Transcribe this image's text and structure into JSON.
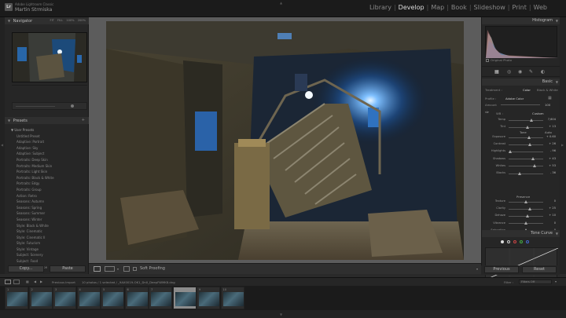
{
  "app": {
    "brand_small": "Adobe Lightroom Classic",
    "brand_name": "Martin Strmiska",
    "logo": "Lr"
  },
  "modules": [
    "Library",
    "Develop",
    "Map",
    "Book",
    "Slideshow",
    "Print",
    "Web"
  ],
  "active_module": "Develop",
  "left_panel": {
    "navigator_title": "Navigator",
    "navigator_zoom": [
      "FIT",
      "FILL",
      "100%",
      "200%"
    ],
    "presets_title": "Presets",
    "presets": [
      {
        "label": "User Presets",
        "type": "group"
      },
      {
        "label": "Untitled Preset",
        "type": "sub"
      },
      {
        "label": "Adaptive: Portrait",
        "type": "item"
      },
      {
        "label": "Adaptive: Sky",
        "type": "item"
      },
      {
        "label": "Adaptive: Subject",
        "type": "item"
      },
      {
        "label": "Portraits: Deep Skin",
        "type": "item"
      },
      {
        "label": "Portraits: Medium Skin",
        "type": "item"
      },
      {
        "label": "Portraits: Light Skin",
        "type": "item"
      },
      {
        "label": "Portraits: Black & White",
        "type": "item"
      },
      {
        "label": "Portraits: Edgy",
        "type": "item"
      },
      {
        "label": "Portraits: Group",
        "type": "item"
      },
      {
        "label": "Action: Retro",
        "type": "item"
      },
      {
        "label": "Seasons: Autumn",
        "type": "item"
      },
      {
        "label": "Seasons: Spring",
        "type": "item"
      },
      {
        "label": "Seasons: Summer",
        "type": "item"
      },
      {
        "label": "Seasons: Winter",
        "type": "item"
      },
      {
        "label": "Style: Black & White",
        "type": "item"
      },
      {
        "label": "Style: Cinematic",
        "type": "item"
      },
      {
        "label": "Style: Cinematic II",
        "type": "item"
      },
      {
        "label": "Style: Futurism",
        "type": "item"
      },
      {
        "label": "Style: Vintage",
        "type": "item"
      },
      {
        "label": "Subject: Scenery",
        "type": "item"
      },
      {
        "label": "Subject: Food",
        "type": "item"
      },
      {
        "label": "Subject: Landscape",
        "type": "item"
      }
    ],
    "copy_label": "Copy...",
    "paste_label": "Paste"
  },
  "toolbar": {
    "soft_proofing": "Soft Proofing"
  },
  "right_panel": {
    "histogram_title": "Histogram",
    "histogram_info": "Original Photo",
    "basic_title": "Basic",
    "treatment_label": "Treatment :",
    "treatment_color": "Color",
    "treatment_bw": "Black & White",
    "profile_label": "Profile :",
    "profile_value": "Adobe Color",
    "amount_label": "Amount",
    "amount_value": "100",
    "wb_label": "WB :",
    "wb_value": "Custom",
    "tone_label": "Tone",
    "auto_label": "Auto",
    "presence_label": "Presence",
    "tone_curve_title": "Tone Curve",
    "previous_label": "Previous",
    "reset_label": "Reset",
    "sliders": [
      {
        "label": "Temp",
        "value": "7,604",
        "pos": 0.66,
        "section": "wb"
      },
      {
        "label": "Tint",
        "value": "+ 13",
        "pos": 0.55,
        "section": "wb"
      },
      {
        "label": "Exposure",
        "value": "+ 0.60",
        "pos": 0.58,
        "section": "tone"
      },
      {
        "label": "Contrast",
        "value": "+ 26",
        "pos": 0.62,
        "section": "tone"
      },
      {
        "label": "Highlights",
        "value": "- 96",
        "pos": 0.05,
        "section": "tone"
      },
      {
        "label": "Shadows",
        "value": "+ 43",
        "pos": 0.71,
        "section": "tone"
      },
      {
        "label": "Whites",
        "value": "+ 53",
        "pos": 0.76,
        "section": "tone"
      },
      {
        "label": "Blacks",
        "value": "- 36",
        "pos": 0.32,
        "section": "tone"
      },
      {
        "label": "Texture",
        "value": "0",
        "pos": 0.5,
        "section": "presence"
      },
      {
        "label": "Clarity",
        "value": "+ 25",
        "pos": 0.62,
        "section": "presence"
      },
      {
        "label": "Dehaze",
        "value": "+ 10",
        "pos": 0.55,
        "section": "presence"
      },
      {
        "label": "Vibrance",
        "value": "0",
        "pos": 0.5,
        "section": "presence"
      },
      {
        "label": "Saturation",
        "value": "0",
        "pos": 0.5,
        "section": "presence"
      }
    ]
  },
  "filmstrip": {
    "previous_import": "Previous Import",
    "info": "10 photos / 1 selected / _9AX0019-OK1_Dn0_DeepFWMK8.dng",
    "filter_label": "Filter :",
    "filter_value": "Filters Off",
    "thumb_numbers": [
      "1",
      "2",
      "3",
      "4",
      "5",
      "6",
      "7",
      "8",
      "9",
      "10"
    ],
    "selected_index": 7
  }
}
